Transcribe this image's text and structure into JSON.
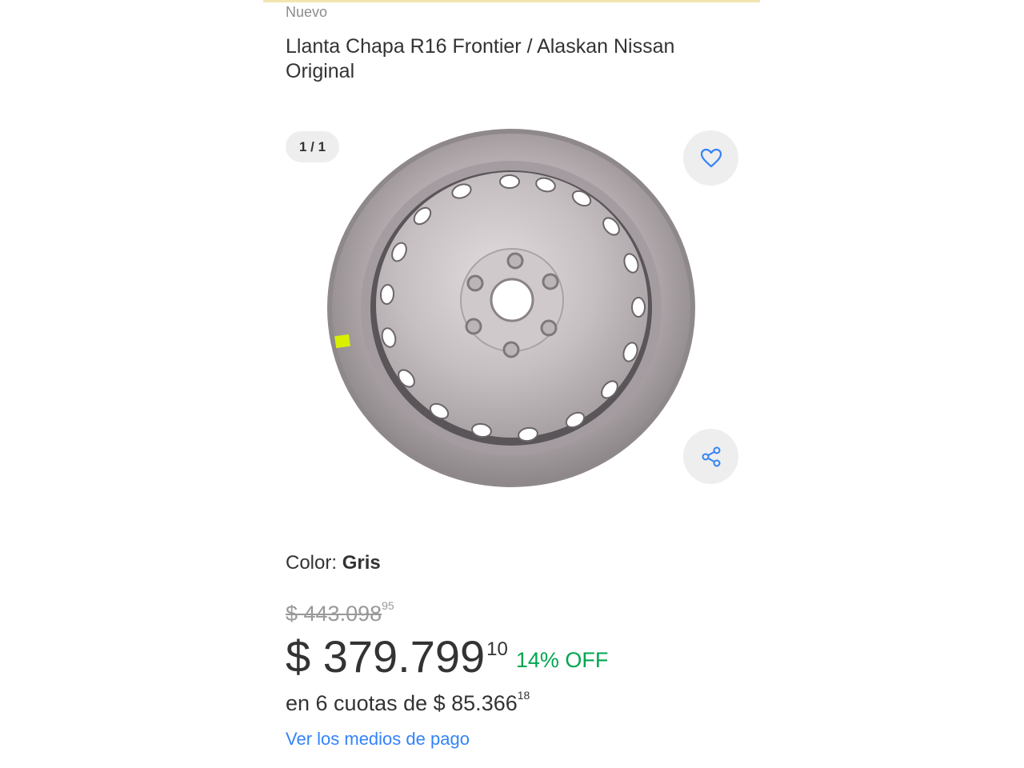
{
  "product": {
    "condition": "Nuevo",
    "title": "Llanta Chapa R16 Frontier / Alaskan Nissan Original"
  },
  "gallery": {
    "counter": "1 / 1",
    "favorite_icon": "heart-icon",
    "share_icon": "share-icon"
  },
  "variant": {
    "color_label": "Color:",
    "color_value": "Gris"
  },
  "pricing": {
    "original_amount": "$ 443.098",
    "original_cents": "95",
    "current_amount": "$ 379.799",
    "current_cents": "10",
    "discount": "14% OFF",
    "installments_text": "en 6 cuotas de $ 85.366",
    "installments_cents": "18",
    "payment_link": "Ver los medios de pago"
  },
  "colors": {
    "accent_blue": "#3483fa",
    "discount_green": "#00a650",
    "text": "#333333"
  }
}
